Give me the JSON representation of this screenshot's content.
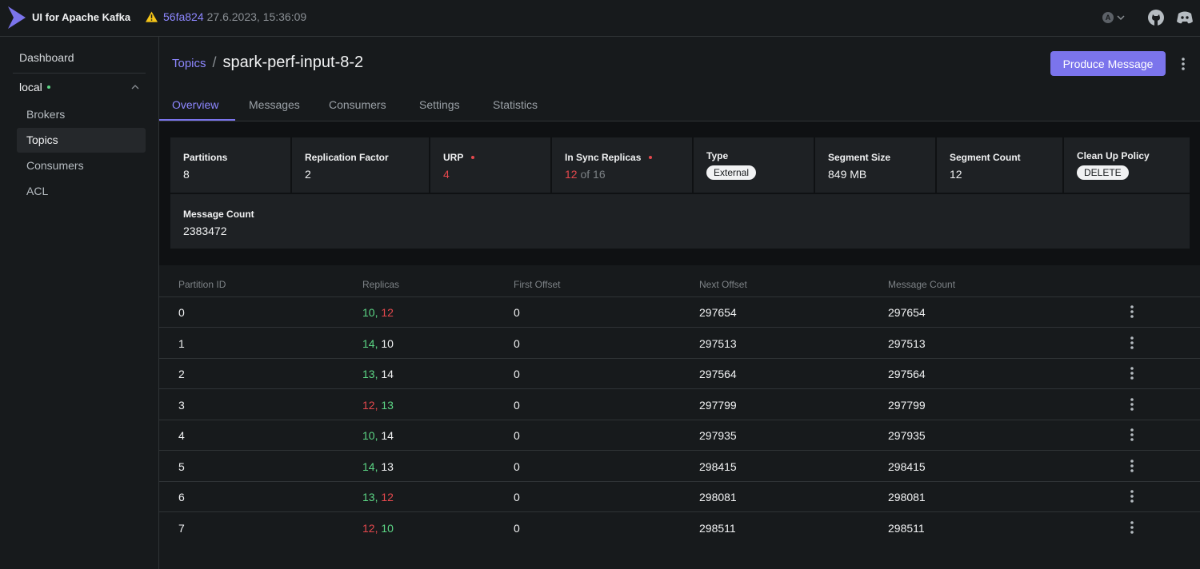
{
  "navbar": {
    "app_title": "UI for Apache Kafka",
    "version_hash": "56fa824",
    "version_date": "27.6.2023, 15:36:09",
    "user_initial": "A"
  },
  "sidebar": {
    "dashboard": "Dashboard",
    "cluster": "local",
    "items": [
      {
        "label": "Brokers",
        "active": false
      },
      {
        "label": "Topics",
        "active": true
      },
      {
        "label": "Consumers",
        "active": false
      },
      {
        "label": "ACL",
        "active": false
      }
    ]
  },
  "header": {
    "breadcrumb_link": "Topics",
    "breadcrumb_sep": "/",
    "title": "spark-perf-input-8-2",
    "produce_label": "Produce Message"
  },
  "tabs": [
    "Overview",
    "Messages",
    "Consumers",
    "Settings",
    "Statistics"
  ],
  "stats": {
    "partitions": {
      "label": "Partitions",
      "value": "8"
    },
    "replication": {
      "label": "Replication Factor",
      "value": "2"
    },
    "urp": {
      "label": "URP",
      "value": "4"
    },
    "isr": {
      "label": "In Sync Replicas",
      "value": "12",
      "suffix": " of 16"
    },
    "type": {
      "label": "Type",
      "value": "External"
    },
    "segment_size": {
      "label": "Segment Size",
      "value": "849 MB"
    },
    "segment_count": {
      "label": "Segment Count",
      "value": "12"
    },
    "cleanup": {
      "label": "Clean Up Policy",
      "value": "DELETE"
    },
    "message_count": {
      "label": "Message Count",
      "value": "2383472"
    }
  },
  "table": {
    "headers": [
      "Partition ID",
      "Replicas",
      "First Offset",
      "Next Offset",
      "Message Count"
    ],
    "rows": [
      {
        "id": "0",
        "r1": "10,",
        "r1c": "g",
        "r2": "12",
        "r2c": "r",
        "first": "0",
        "next": "297654",
        "count": "297654"
      },
      {
        "id": "1",
        "r1": "14,",
        "r1c": "g",
        "r2": "10",
        "r2c": "w",
        "first": "0",
        "next": "297513",
        "count": "297513"
      },
      {
        "id": "2",
        "r1": "13,",
        "r1c": "g",
        "r2": "14",
        "r2c": "w",
        "first": "0",
        "next": "297564",
        "count": "297564"
      },
      {
        "id": "3",
        "r1": "12,",
        "r1c": "r",
        "r2": "13",
        "r2c": "g",
        "first": "0",
        "next": "297799",
        "count": "297799"
      },
      {
        "id": "4",
        "r1": "10,",
        "r1c": "g",
        "r2": "14",
        "r2c": "w",
        "first": "0",
        "next": "297935",
        "count": "297935"
      },
      {
        "id": "5",
        "r1": "14,",
        "r1c": "g",
        "r2": "13",
        "r2c": "w",
        "first": "0",
        "next": "298415",
        "count": "298415"
      },
      {
        "id": "6",
        "r1": "13,",
        "r1c": "g",
        "r2": "12",
        "r2c": "r",
        "first": "0",
        "next": "298081",
        "count": "298081"
      },
      {
        "id": "7",
        "r1": "12,",
        "r1c": "r",
        "r2": "10",
        "r2c": "g",
        "first": "0",
        "next": "298511",
        "count": "298511"
      }
    ]
  },
  "colors": {
    "accent": "#7b74ec",
    "link": "#8d87ff",
    "green": "#5cd685",
    "red": "#e5484d"
  }
}
